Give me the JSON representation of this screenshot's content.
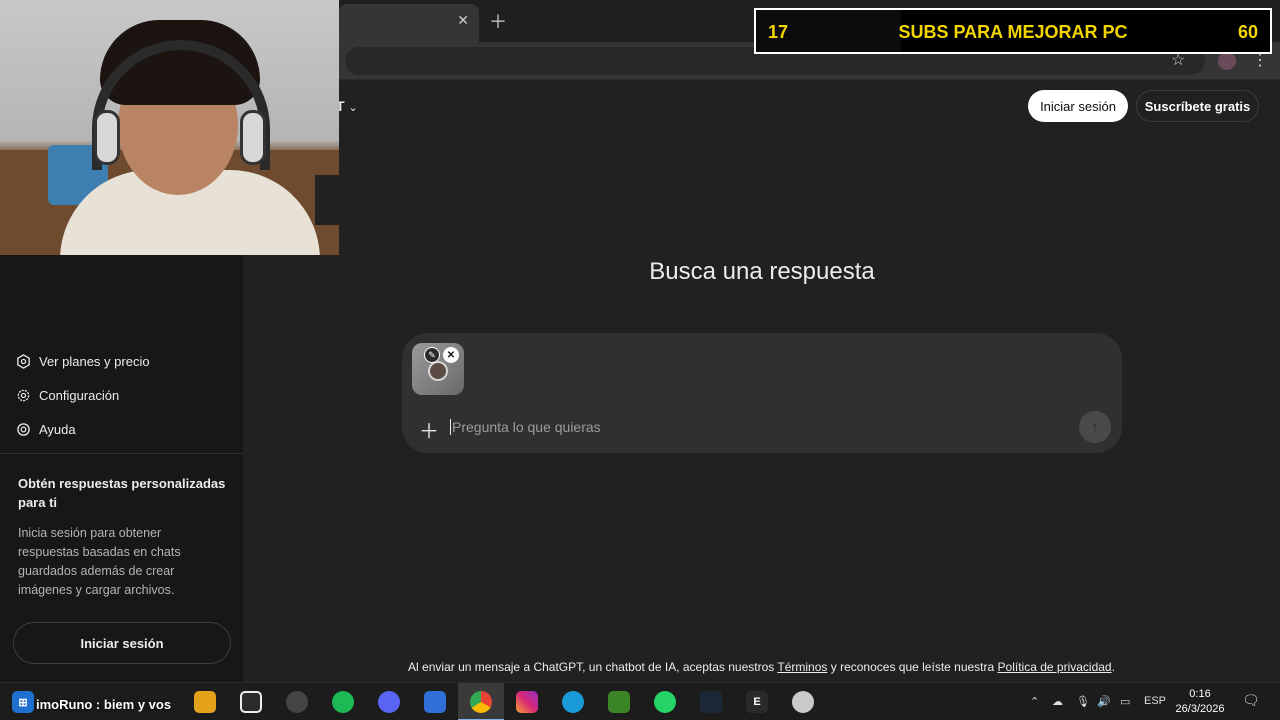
{
  "overlay": {
    "current_subs": "17",
    "goal_label": "SUBS PARA MEJORAR PC",
    "goal_target": "60",
    "progress": 0.283
  },
  "header": {
    "login": "Iniciar sesión",
    "signup": "Suscríbete gratis"
  },
  "sidebar": {
    "items": [
      {
        "label": "Ver planes y precio",
        "icon": "plans-icon"
      },
      {
        "label": "Configuración",
        "icon": "gear-icon"
      },
      {
        "label": "Ayuda",
        "icon": "help-icon"
      }
    ],
    "promo_title": "Obtén respuestas personalizadas para ti",
    "promo_body": "Inicia sesión para obtener respuestas basadas en chats guardados además de crear imágenes y cargar archivos.",
    "login_button": "Iniciar sesión"
  },
  "main": {
    "heading": "Busca una respuesta",
    "input_placeholder": "Pregunta lo que quieras",
    "input_value": ""
  },
  "footer": {
    "prefix": "Al enviar un mensaje a ChatGPT, un chatbot de IA, aceptas nuestros",
    "terms": "Términos",
    "middle": "y reconoces que leíste nuestra",
    "privacy": "Política de privacidad",
    "suffix": "."
  },
  "taskbar": {
    "ticker": "imoRuno : biem y vos",
    "lang": "ESP",
    "time": "0:16",
    "date": "26/3/2026"
  }
}
